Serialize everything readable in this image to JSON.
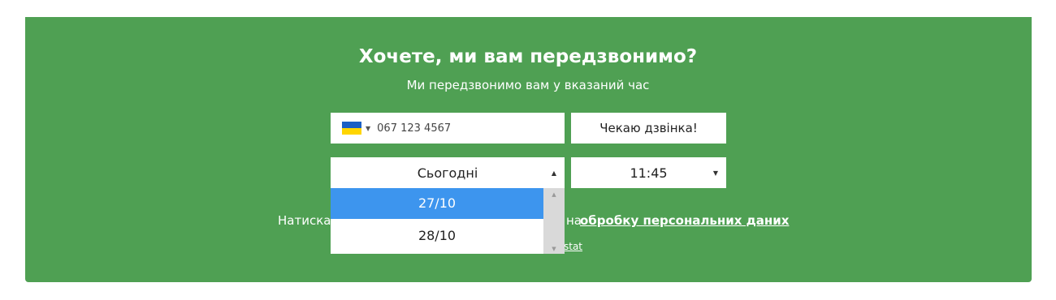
{
  "callback": {
    "title": "Хочете, ми вам передзвонимо?",
    "subtitle": "Ми передзвонимо вам у вказаний час",
    "phone": {
      "country_icon": "ukraine-flag-icon",
      "placeholder": "067 123 4567"
    },
    "submit_label": "Чекаю дзвінка!",
    "day_select": {
      "value": "Сьогодні",
      "options": [
        {
          "label": "27/10",
          "selected": true
        },
        {
          "label": "28/10",
          "selected": false
        }
      ]
    },
    "time_select": {
      "value": "11:45"
    },
    "consent": {
      "prefix": "Натиска",
      "middle": "на",
      "link": "обробку персональних даних"
    },
    "footer_link": "stat"
  },
  "colors": {
    "panel": "#4fa053",
    "selected_option": "#3d95ee",
    "scrollbar": "#d9d9d9"
  }
}
